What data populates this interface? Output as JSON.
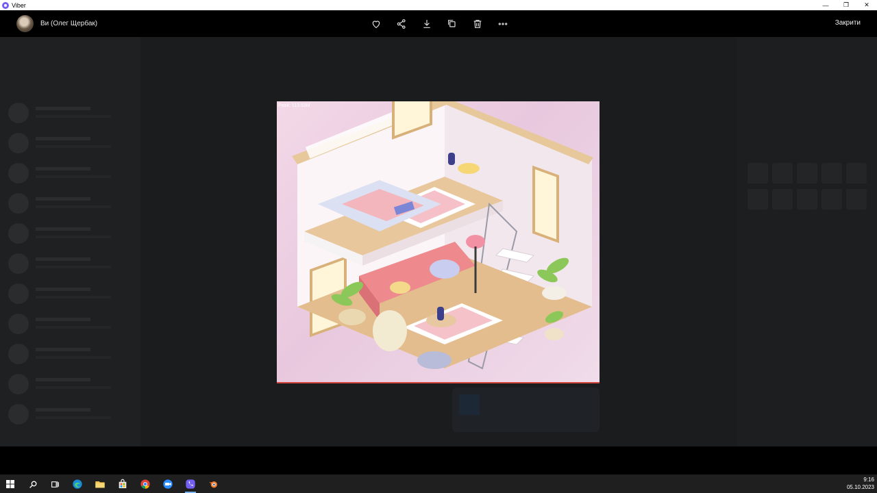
{
  "window": {
    "title": "Viber",
    "minimize": "—",
    "restore": "❐",
    "close": "✕"
  },
  "viewer": {
    "contact_name": "Ви (Олег Щербак)",
    "close_label": "Закрити",
    "actions": [
      "heart-icon",
      "share-icon",
      "download-icon",
      "forward-icon",
      "trash-icon",
      "more-icon"
    ]
  },
  "photo": {
    "overlay_text": "Peak: 113.53M"
  },
  "taskbar": {
    "apps": [
      "windows-start-icon",
      "search-icon",
      "task-view-icon",
      "edge-icon",
      "file-explorer-icon",
      "store-icon",
      "chrome-icon",
      "zoom-icon",
      "viber-icon",
      "blender-icon"
    ],
    "time": "9:16",
    "date": "05.10.2023"
  },
  "colors": {
    "accent": "#7360f2",
    "progress": "#d2443c"
  }
}
